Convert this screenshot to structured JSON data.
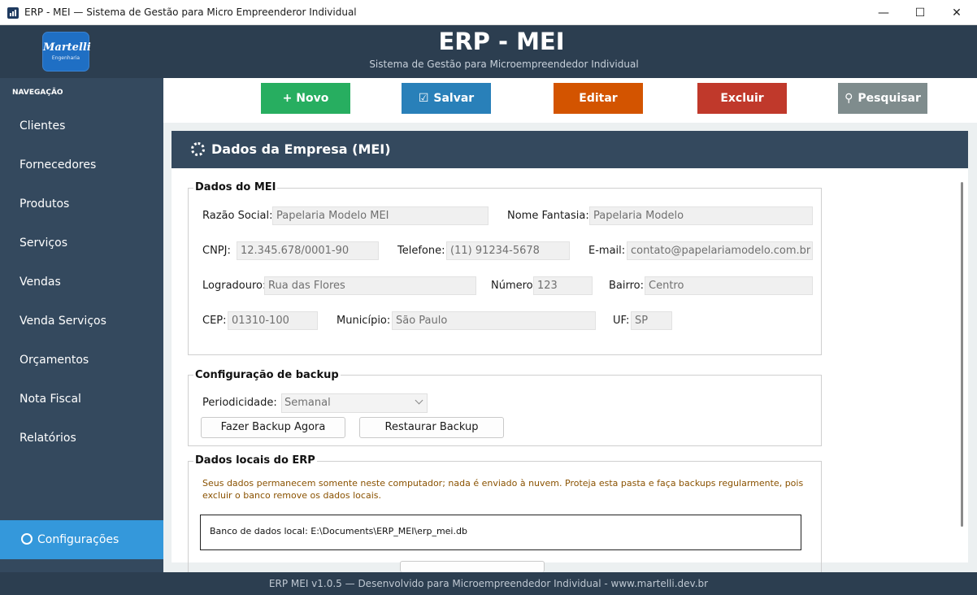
{
  "window": {
    "title": "ERP - MEI — Sistema de Gestão para Micro Empreenderor Individual",
    "minimize": "—",
    "maximize": "☐",
    "close": "✕"
  },
  "header": {
    "logo_name": "Martelli",
    "logo_sub": "Engenharia",
    "title": "ERP - MEI",
    "subtitle": "Sistema de Gestão para Microempreendedor Individual"
  },
  "sidebar": {
    "section_label": "NAVEGAÇÃO",
    "items": [
      {
        "label": "Clientes"
      },
      {
        "label": "Fornecedores"
      },
      {
        "label": "Produtos"
      },
      {
        "label": "Serviços"
      },
      {
        "label": "Vendas"
      },
      {
        "label": "Venda Serviços"
      },
      {
        "label": "Orçamentos"
      },
      {
        "label": "Nota Fiscal"
      },
      {
        "label": "Relatórios"
      }
    ],
    "settings_label": "Configurações"
  },
  "toolbar": {
    "new_label": "+ Novo",
    "save_label": "Salvar",
    "edit_label": "Editar",
    "delete_label": "Excluir",
    "search_label": "Pesquisar",
    "colors": {
      "new": "#27ae60",
      "save": "#2980b9",
      "edit": "#d35400",
      "delete": "#c0392b",
      "search": "#7f8c8d"
    }
  },
  "panel": {
    "title": "Dados da Empresa (MEI)"
  },
  "mei": {
    "group_title": "Dados do MEI",
    "razao_label": "Razão Social:",
    "razao_value": "Papelaria Modelo MEI",
    "fantasia_label": "Nome Fantasia:",
    "fantasia_value": "Papelaria Modelo",
    "cnpj_label": "CNPJ:",
    "cnpj_value": "12.345.678/0001-90",
    "telefone_label": "Telefone:",
    "telefone_value": "(11) 91234-5678",
    "email_label": "E-mail:",
    "email_value": "contato@papelariamodelo.com.br",
    "logradouro_label": "Logradouro:",
    "logradouro_value": "Rua das Flores",
    "numero_label": "Número:",
    "numero_value": "123",
    "bairro_label": "Bairro:",
    "bairro_value": "Centro",
    "cep_label": "CEP:",
    "cep_value": "01310-100",
    "municipio_label": "Município:",
    "municipio_value": "São Paulo",
    "uf_label": "UF:",
    "uf_value": "SP"
  },
  "backup": {
    "group_title": "Configuração de backup",
    "periodicidade_label": "Periodicidade:",
    "periodicidade_value": "Semanal",
    "backup_now_label": "Fazer Backup Agora",
    "restore_label": "Restaurar Backup"
  },
  "local": {
    "group_title": "Dados locais do ERP",
    "warning_line1": "Seus dados permanecem somente neste computador; nada é enviado à nuvem. Proteja esta pasta e faça backups regularmente, pois",
    "warning_line2": "excluir o banco remove os dados locais.",
    "db_path": "Banco de dados local: E:\\Documents\\ERP_MEI\\erp_mei.db"
  },
  "footer": {
    "text": "ERP MEI v1.0.5  —  Desenvolvido para Microempreendedor Individual  -  www.martelli.dev.br"
  }
}
